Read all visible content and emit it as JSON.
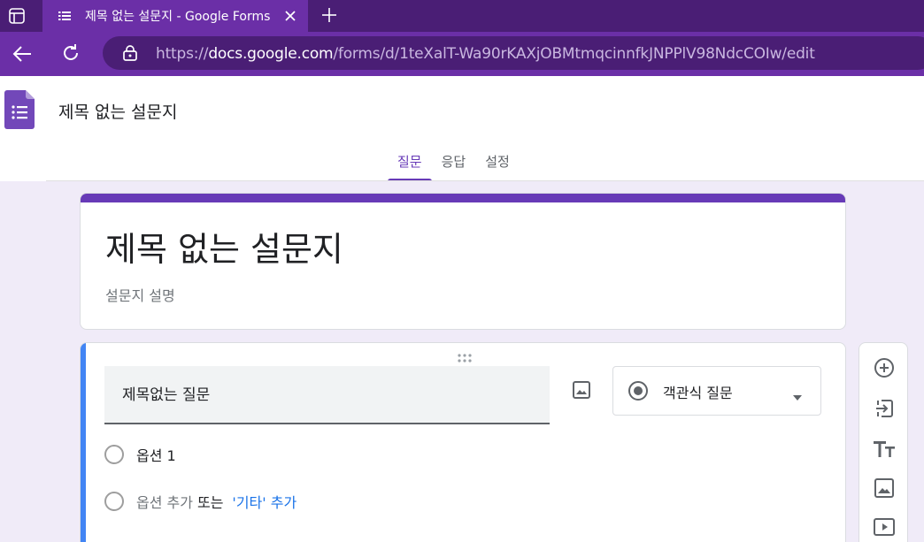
{
  "browser": {
    "tab_title": "제목 없는 설문지 - Google Forms",
    "url_scheme": "https://",
    "url_domain": "docs.google.com",
    "url_path": "/forms/d/1teXalT-Wa90rKAXjOBMtmqcinnfkJNPPlV98NdcCOIw/edit",
    "colors": {
      "tabstrip": "#4a1e75",
      "toolbar": "#6b2fa7"
    }
  },
  "app": {
    "doc_title": "제목 없는 설문지",
    "tabs": [
      {
        "label": "질문",
        "active": true
      },
      {
        "label": "응답",
        "active": false
      },
      {
        "label": "설정",
        "active": false
      }
    ],
    "accent": "#673ab7"
  },
  "form": {
    "title": "제목 없는 설문지",
    "description": "설문지 설명"
  },
  "question": {
    "title": "제목없는 질문",
    "type_label": "객관식 질문",
    "options": [
      {
        "label": "옵션 1"
      }
    ],
    "add_option_label": "옵션 추가",
    "or_label": "또는",
    "add_other_label": "'기타' 추가"
  },
  "side_toolbar": {
    "icons": [
      "add-question-icon",
      "import-questions-icon",
      "add-title-icon",
      "add-image-icon",
      "add-video-icon"
    ]
  }
}
